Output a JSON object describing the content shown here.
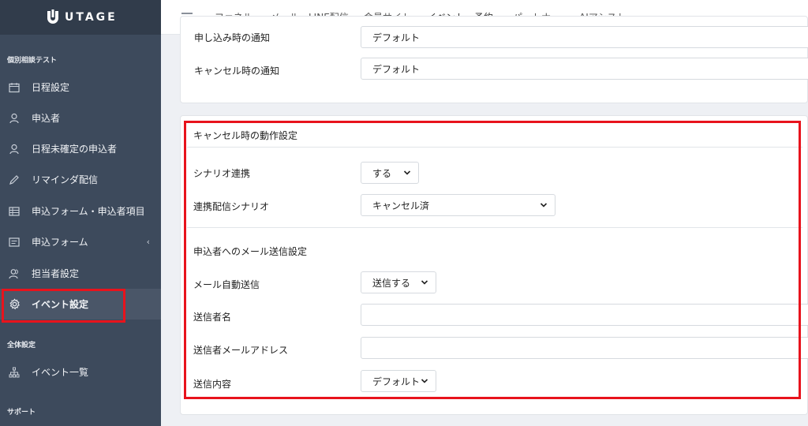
{
  "brand": {
    "name": "UTAGE"
  },
  "sidebar": {
    "section1": "個別相談テスト",
    "items": [
      {
        "label": "日程設定",
        "icon": "calendar-icon"
      },
      {
        "label": "申込者",
        "icon": "person-icon"
      },
      {
        "label": "日程未確定の申込者",
        "icon": "person-icon"
      },
      {
        "label": "リマインダ配信",
        "icon": "pencil-icon"
      },
      {
        "label": "申込フォーム・申込者項目",
        "icon": "table-icon"
      },
      {
        "label": "申込フォーム",
        "icon": "form-icon",
        "arrow": "‹"
      },
      {
        "label": "担当者設定",
        "icon": "people-icon"
      },
      {
        "label": "イベント設定",
        "icon": "gear-icon",
        "active": true
      }
    ],
    "section2": "全体設定",
    "items2": [
      {
        "label": "イベント一覧",
        "icon": "sitemap-icon"
      }
    ],
    "section3": "サポート"
  },
  "topnav": {
    "tabs": [
      "ファネル",
      "メール・LINE配信",
      "会員サイト",
      "イベント・予約",
      "パートナー",
      "AIアシスト"
    ],
    "active": "イベント・予約"
  },
  "notify_card": {
    "rows": [
      {
        "label": "申し込み時の通知",
        "value": "デフォルト"
      },
      {
        "label": "キャンセル時の通知",
        "value": "デフォルト"
      }
    ]
  },
  "cancel_card": {
    "title": "キャンセル時の動作設定",
    "scenario_link_label": "シナリオ連携",
    "scenario_link_value": "する",
    "scenario_label": "連携配信シナリオ",
    "scenario_value": "キャンセル済",
    "mail_section_title": "申込者へのメール送信設定",
    "auto_mail_label": "メール自動送信",
    "auto_mail_value": "送信する",
    "sender_name_label": "送信者名",
    "sender_name_value": "",
    "sender_email_label": "送信者メールアドレス",
    "sender_email_value": "",
    "content_label": "送信内容",
    "content_value": "デフォルト"
  },
  "colors": {
    "highlight": "#e8131c",
    "sidebar": "#3d4a5c",
    "accent": "#4b9bd6"
  }
}
